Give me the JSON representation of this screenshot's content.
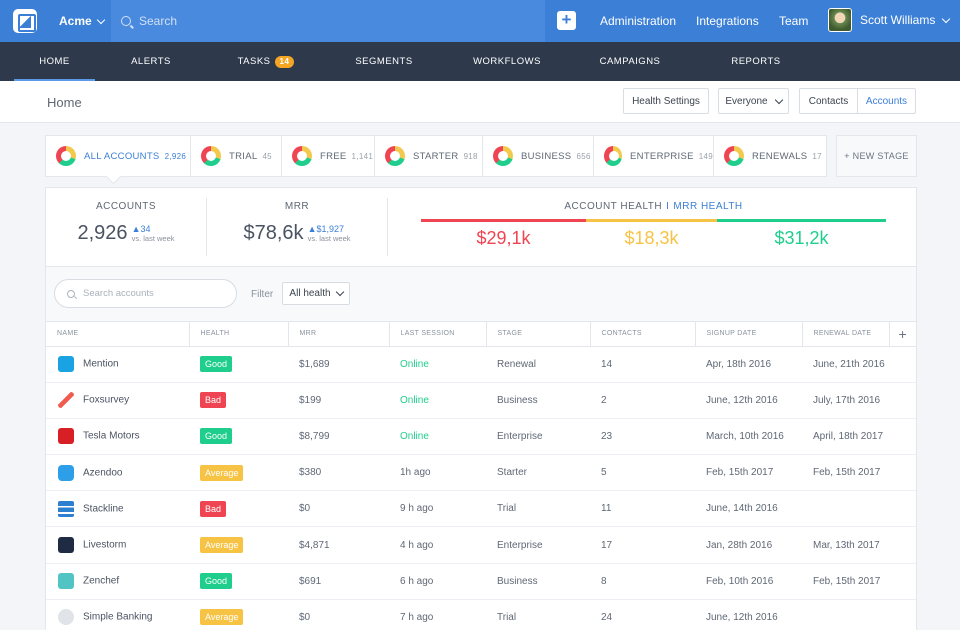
{
  "topbar": {
    "org": "Acme",
    "search_placeholder": "Search",
    "nav": [
      "Administration",
      "Integrations",
      "Team"
    ],
    "user": "Scott Williams"
  },
  "nav": {
    "items": [
      "HOME",
      "ALERTS",
      "TASKS",
      "SEGMENTS",
      "WORKFLOWS",
      "CAMPAIGNS",
      "REPORTS"
    ],
    "tasks_badge": "14",
    "active": "HOME"
  },
  "subheader": {
    "title": "Home",
    "health_settings": "Health Settings",
    "everyone": "Everyone",
    "contacts": "Contacts",
    "accounts": "Accounts"
  },
  "stages": [
    {
      "label": "ALL ACCOUNTS",
      "count": "2,926"
    },
    {
      "label": "TRIAL",
      "count": "45"
    },
    {
      "label": "FREE",
      "count": "1,141"
    },
    {
      "label": "STARTER",
      "count": "918"
    },
    {
      "label": "BUSINESS",
      "count": "656"
    },
    {
      "label": "ENTERPRISE",
      "count": "149"
    },
    {
      "label": "RENEWALS",
      "count": "17"
    }
  ],
  "new_stage": "+ NEW STAGE",
  "kpis": {
    "accounts": {
      "label": "ACCOUNTS",
      "value": "2,926",
      "delta": "34",
      "vs": "vs. last week"
    },
    "mrr": {
      "label": "MRR",
      "value": "$78,6k",
      "delta": "$1,927",
      "vs": "vs. last week"
    },
    "health": {
      "label": "ACCOUNT HEALTH",
      "sep": "I",
      "mrr_label": "MRR HEALTH",
      "bad": "$29,1k",
      "average": "$18,3k",
      "good": "$31,2k"
    }
  },
  "colors": {
    "bad": "#ef4452",
    "average": "#f6c344",
    "good": "#1fce8c",
    "accent": "#3b7fd6"
  },
  "toolbar": {
    "search_placeholder": "Search accounts",
    "filter_label": "Filter",
    "filter_value": "All health"
  },
  "table": {
    "headers": [
      "NAME",
      "HEALTH",
      "MRR",
      "LAST SESSION",
      "STAGE",
      "CONTACTS",
      "SIGNUP DATE",
      "RENEWAL DATE",
      "+"
    ],
    "rows": [
      {
        "name": "Mention",
        "icon": "mention-logo-icon",
        "health": "Good",
        "mrr": "$1,689",
        "session": "Online",
        "stage": "Renewal",
        "contacts": "14",
        "signup": "Apr, 18th 2016",
        "renewal": "June, 21th 2016"
      },
      {
        "name": "Foxsurvey",
        "icon": "foxsurvey-logo-icon",
        "health": "Bad",
        "mrr": "$199",
        "session": "Online",
        "stage": "Business",
        "contacts": "2",
        "signup": "June, 12th 2016",
        "renewal": "July, 17th 2016"
      },
      {
        "name": "Tesla Motors",
        "icon": "tesla-logo-icon",
        "health": "Good",
        "mrr": "$8,799",
        "session": "Online",
        "stage": "Enterprise",
        "contacts": "23",
        "signup": "March, 10th 2016",
        "renewal": "April, 18th 2017"
      },
      {
        "name": "Azendoo",
        "icon": "azendoo-logo-icon",
        "health": "Average",
        "mrr": "$380",
        "session": "1h ago",
        "stage": "Starter",
        "contacts": "5",
        "signup": "Feb, 15th 2017",
        "renewal": "Feb, 15th 2017"
      },
      {
        "name": "Stackline",
        "icon": "stackline-logo-icon",
        "health": "Bad",
        "mrr": "$0",
        "session": "9 h ago",
        "stage": "Trial",
        "contacts": "11",
        "signup": "June, 14th 2016",
        "renewal": ""
      },
      {
        "name": "Livestorm",
        "icon": "livestorm-logo-icon",
        "health": "Average",
        "mrr": "$4,871",
        "session": "4 h ago",
        "stage": "Enterprise",
        "contacts": "17",
        "signup": "Jan, 28th 2016",
        "renewal": "Mar, 13th 2017"
      },
      {
        "name": "Zenchef",
        "icon": "zenchef-logo-icon",
        "health": "Good",
        "mrr": "$691",
        "session": "6 h ago",
        "stage": "Business",
        "contacts": "8",
        "signup": "Feb, 10th 2016",
        "renewal": "Feb, 15th 2017"
      },
      {
        "name": "Simple Banking",
        "icon": "simple-banking-logo-icon",
        "health": "Average",
        "mrr": "$0",
        "session": "7 h ago",
        "stage": "Trial",
        "contacts": "24",
        "signup": "June, 12th 2016",
        "renewal": ""
      }
    ]
  }
}
